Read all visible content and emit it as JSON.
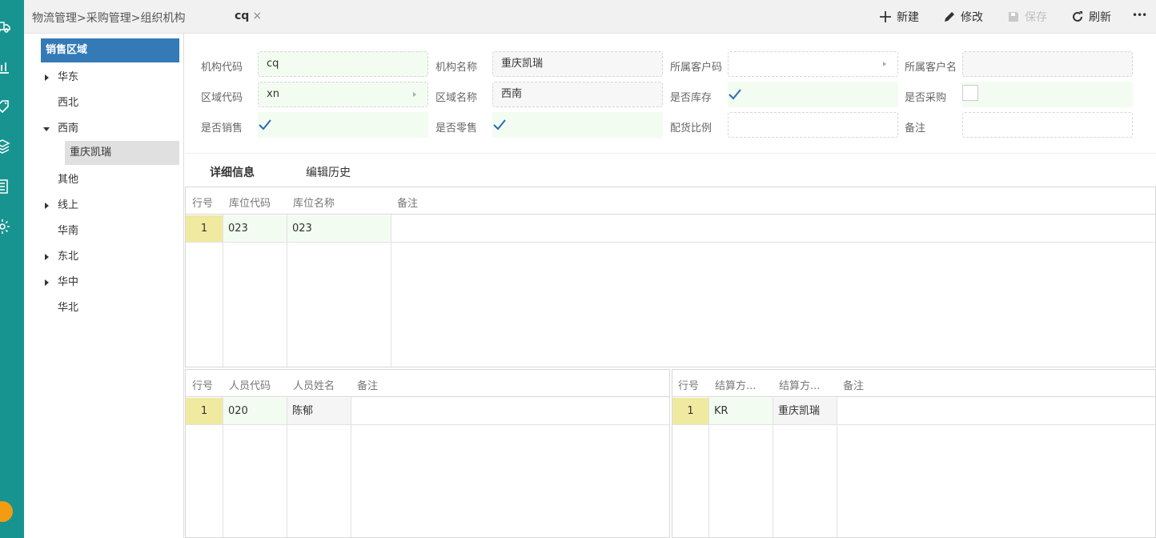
{
  "rail": {
    "icons": [
      "truck-icon",
      "chart-icon",
      "tag-icon",
      "layers-icon",
      "document-icon",
      "gear-icon",
      "cloud-icon"
    ]
  },
  "header": {
    "breadcrumb": "物流管理>采购管理>组织机构",
    "tab_label": "cq",
    "tab_close": "×",
    "toolbar": {
      "new_label": "新建",
      "edit_label": "修改",
      "save_label": "保存",
      "refresh_label": "刷新",
      "more_label": "•••"
    }
  },
  "tree": {
    "root": "销售区域",
    "items": [
      {
        "label": "华东"
      },
      {
        "label": "西北"
      },
      {
        "label": "西南"
      },
      {
        "label": "重庆凯瑞"
      },
      {
        "label": "其他"
      },
      {
        "label": "线上"
      },
      {
        "label": "华南"
      },
      {
        "label": "东北"
      },
      {
        "label": "华中"
      },
      {
        "label": "华北"
      }
    ]
  },
  "form": {
    "org_code_label": "机构代码",
    "org_code_value": "cq",
    "org_name_label": "机构名称",
    "org_name_value": "重庆凯瑞",
    "cust_code_label": "所属客户码",
    "cust_code_value": "",
    "cust_name_label": "所属客户名",
    "cust_name_value": "",
    "region_code_label": "区域代码",
    "region_code_value": "xn",
    "region_name_label": "区域名称",
    "region_name_value": "西南",
    "stock_label": "是否库存",
    "purchase_label": "是否采购",
    "sales_label": "是否销售",
    "retail_label": "是否零售",
    "ratio_label": "配货比例",
    "ratio_value": "",
    "remark_label": "备注",
    "remark_value": ""
  },
  "subtabs": {
    "detail": "详细信息",
    "history": "编辑历史"
  },
  "warehouse_grid": {
    "headers": [
      "行号",
      "库位代码",
      "库位名称",
      "备注"
    ],
    "rows": [
      {
        "no": "1",
        "code": "023",
        "name": "023",
        "remark": ""
      }
    ]
  },
  "staff_grid": {
    "headers": [
      "行号",
      "人员代码",
      "人员姓名",
      "备注"
    ],
    "rows": [
      {
        "no": "1",
        "code": "020",
        "name": "陈郁",
        "remark": ""
      }
    ]
  },
  "settle_grid": {
    "headers": [
      "行号",
      "结算方...",
      "结算方...",
      "备注"
    ],
    "rows": [
      {
        "no": "1",
        "code": "KR",
        "name": "重庆凯瑞",
        "remark": ""
      }
    ]
  },
  "colors": {
    "rail": "#189490",
    "selected": "#337ab7",
    "row_number": "#f0e9a0",
    "editable_field": "#f3fcf1"
  }
}
